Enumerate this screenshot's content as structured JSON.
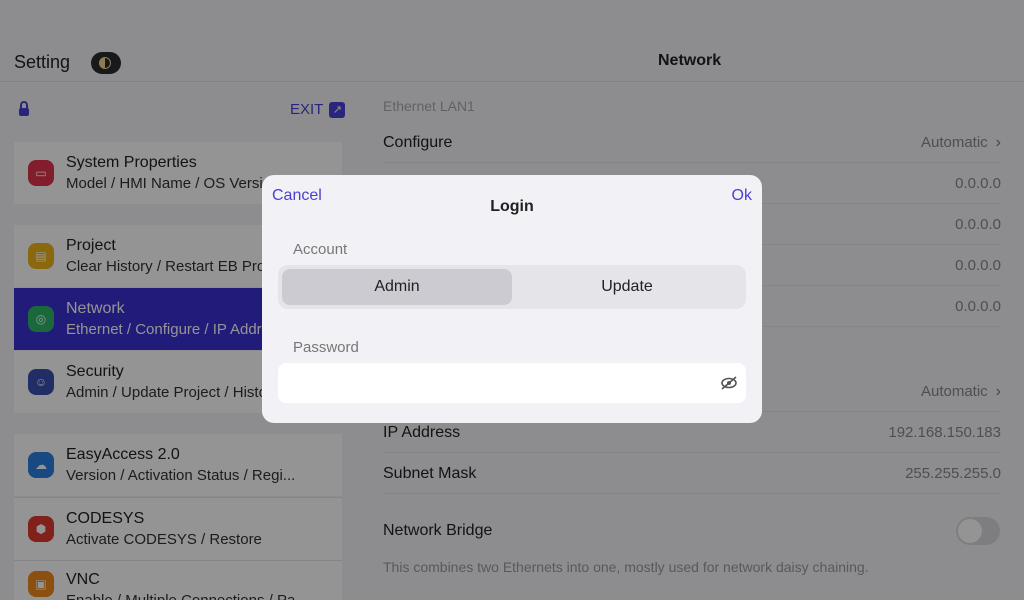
{
  "header": {
    "setting_title": "Setting",
    "page_title": "Network"
  },
  "sidebar": {
    "exit_label": "EXIT",
    "items": [
      {
        "title": "System Properties",
        "subtitle": "Model / HMI Name / OS Version",
        "color": "#e0324b"
      },
      {
        "title": "Project",
        "subtitle": "Clear History / Restart EB Pro",
        "color": "#f0b419"
      },
      {
        "title": "Network",
        "subtitle": "Ethernet / Configure / IP Address",
        "color": "#2fb36a"
      },
      {
        "title": "Security",
        "subtitle": "Admin / Update Project / History",
        "color": "#3a4fb0"
      },
      {
        "title": "EasyAccess 2.0",
        "subtitle": "Version / Activation Status / Regi...",
        "color": "#2a7ee0"
      },
      {
        "title": "CODESYS",
        "subtitle": "Activate CODESYS / Restore",
        "color": "#e03a2f"
      },
      {
        "title": "VNC",
        "subtitle": "Enable / Multiple Connections / Pa...",
        "color": "#f08a1c"
      }
    ]
  },
  "main": {
    "section_label": "Ethernet LAN1",
    "configure_label": "Configure",
    "configure_value": "Automatic",
    "ip_rows": [
      "0.0.0.0",
      "0.0.0.0",
      "0.0.0.0",
      "0.0.0.0"
    ],
    "configure2_value": "Automatic",
    "ip_address_label": "IP Address",
    "ip_address_value": "192.168.150.183",
    "subnet_label": "Subnet Mask",
    "subnet_value": "255.255.255.0",
    "bridge_label": "Network Bridge",
    "bridge_desc": "This combines two Ethernets into one, mostly used for network daisy chaining."
  },
  "modal": {
    "cancel_label": "Cancel",
    "ok_label": "Ok",
    "title": "Login",
    "account_label": "Account",
    "account_options": [
      "Admin",
      "Update"
    ],
    "selected_account": "Admin",
    "password_label": "Password",
    "password_value": ""
  },
  "colors": {
    "accent": "#4a3fd6",
    "active_item": "#3a2fd0"
  }
}
